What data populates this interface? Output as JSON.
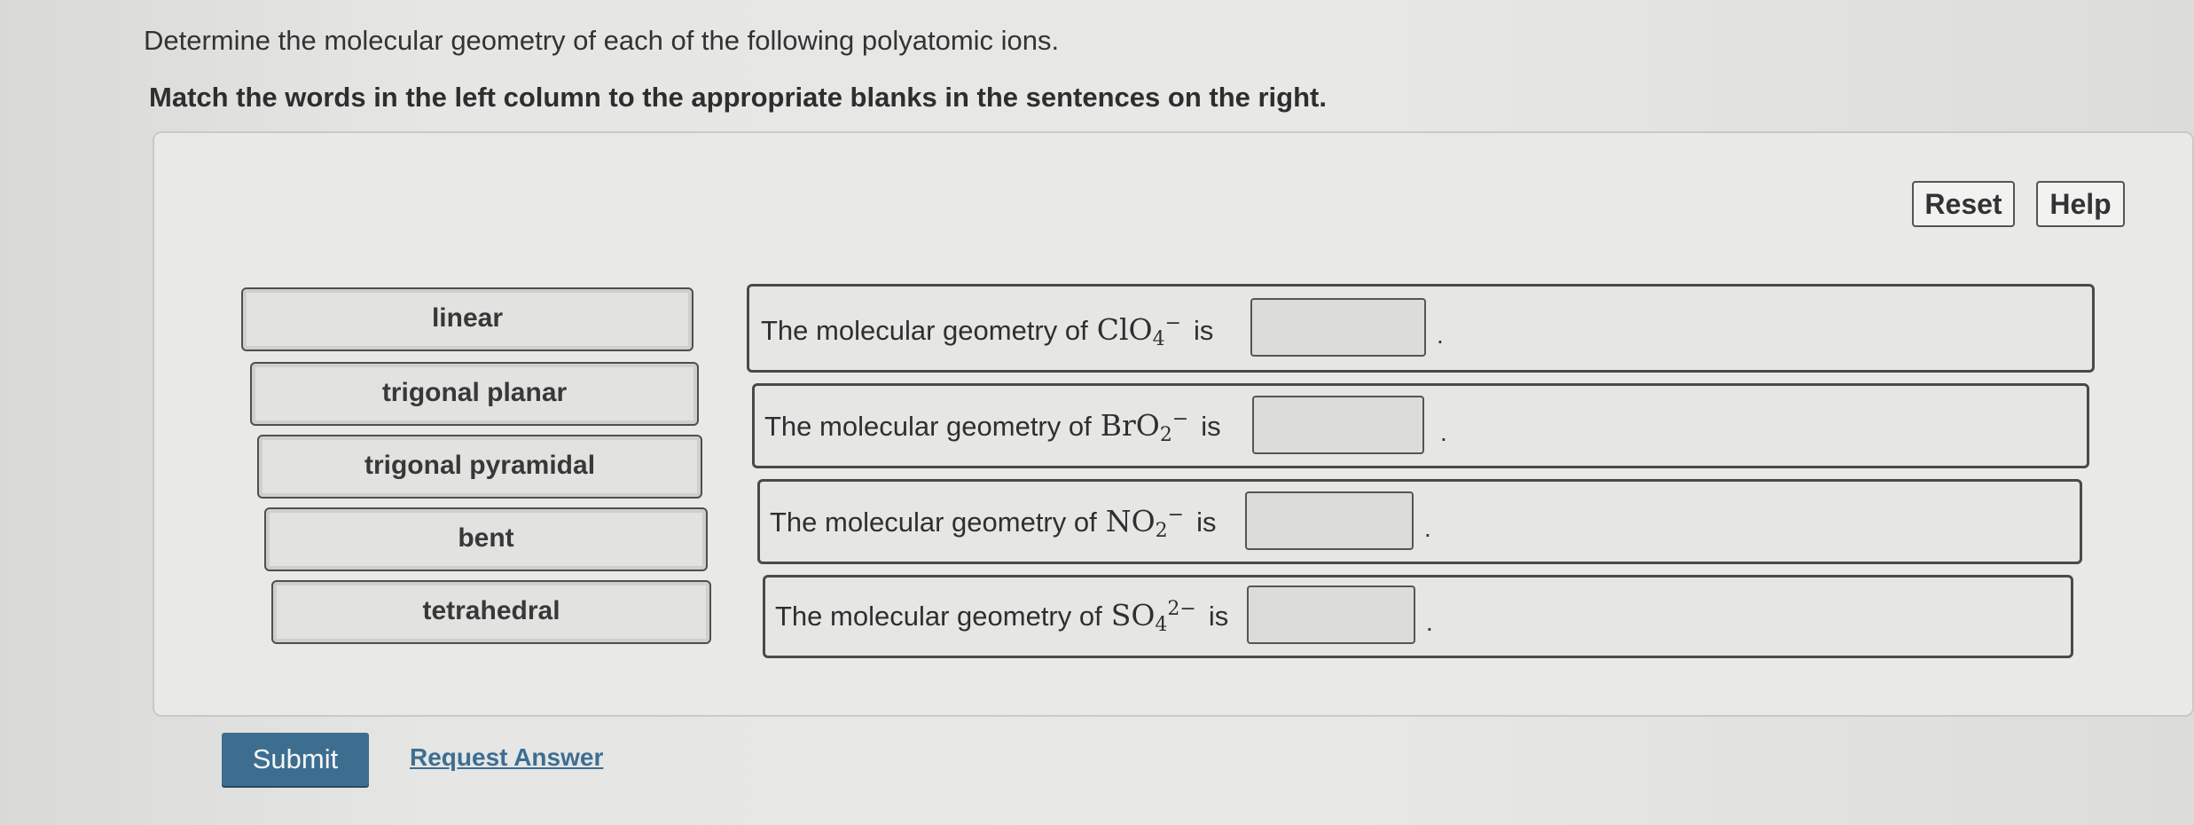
{
  "instruction": "Determine the molecular geometry of each of the following polyatomic ions.",
  "subinstruction": "Match the words in the left column to the appropriate blanks in the sentences on the right.",
  "toolbar": {
    "reset_label": "Reset",
    "help_label": "Help"
  },
  "word_bank": [
    {
      "label": "linear"
    },
    {
      "label": "trigonal planar"
    },
    {
      "label": "trigonal pyramidal"
    },
    {
      "label": "bent"
    },
    {
      "label": "tetrahedral"
    }
  ],
  "sentences": [
    {
      "prefix": "The molecular geometry of",
      "formula_base": "ClO",
      "formula_sub": "4",
      "formula_sup": "−",
      "suffix": "is",
      "period": "."
    },
    {
      "prefix": "The molecular geometry of",
      "formula_base": "BrO",
      "formula_sub": "2",
      "formula_sup": "−",
      "suffix": "is",
      "period": "."
    },
    {
      "prefix": "The molecular geometry of",
      "formula_base": "NO",
      "formula_sub": "2",
      "formula_sup": "−",
      "suffix": "is",
      "period": "."
    },
    {
      "prefix": "The molecular geometry of",
      "formula_base": "SO",
      "formula_sub": "4",
      "formula_sup": "2−",
      "suffix": "is",
      "period": "."
    }
  ],
  "actions": {
    "submit_label": "Submit",
    "request_answer_label": "Request Answer"
  }
}
